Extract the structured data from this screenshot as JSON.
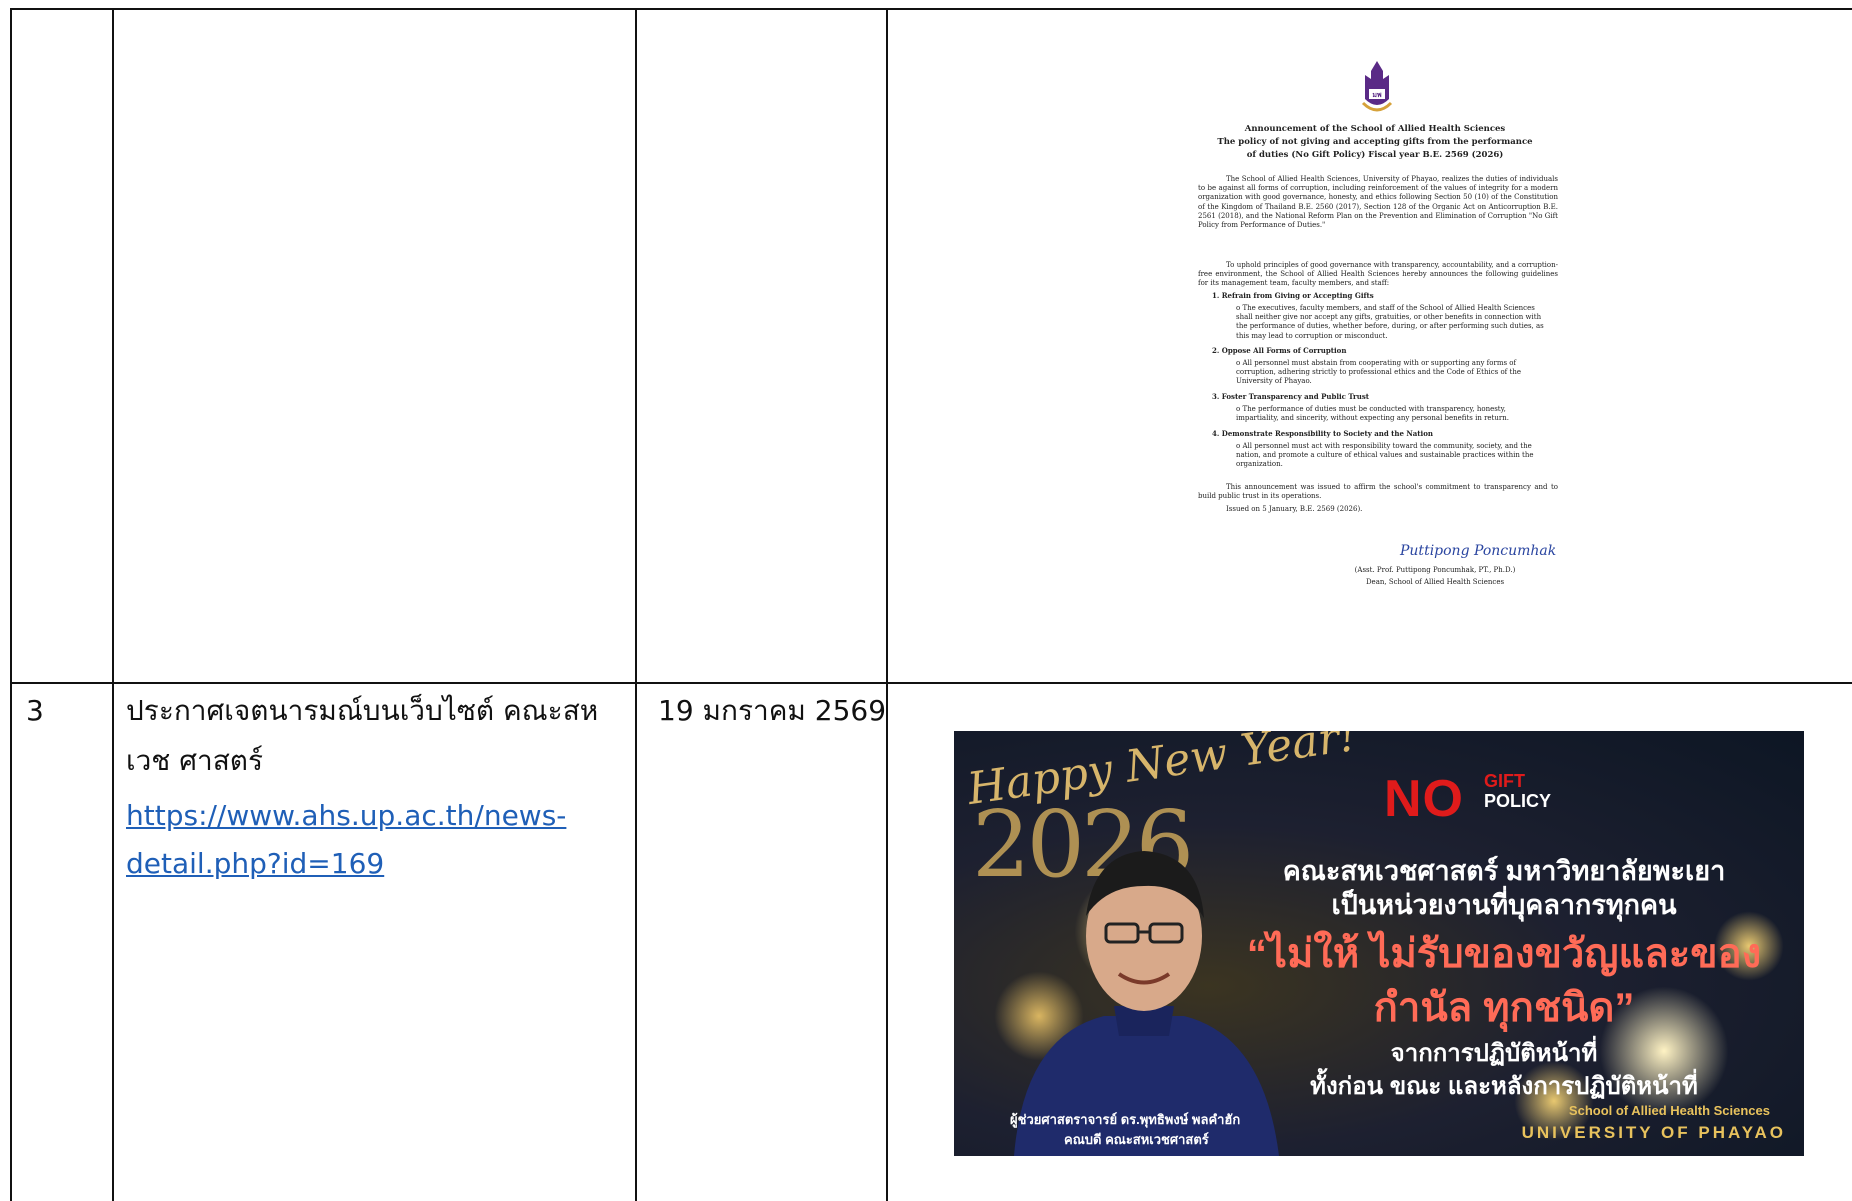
{
  "row2": {
    "announcement": {
      "header_lines": [
        "Announcement of the School of Allied Health Sciences",
        "The policy of not giving and accepting gifts from the performance",
        "of duties (No Gift Policy) Fiscal year B.E. 2569 (2026)"
      ],
      "para1": "The School of Allied Health Sciences, University of Phayao, realizes the duties of individuals to be against all forms of corruption, including reinforcement of the values of integrity for a modern organization with good governance, honesty, and ethics following Section 50 (10) of the Constitution of the Kingdom of Thailand B.E. 2560 (2017), Section 128 of the Organic Act on Anticorruption B.E. 2561 (2018), and the National Reform Plan on the Prevention and Elimination of Corruption \"No Gift Policy from Performance of Duties.\"",
      "para2": "To uphold principles of good governance with transparency, accountability, and a corruption-free environment, the School of Allied Health Sciences hereby announces the following guidelines for its management team, faculty members, and staff:",
      "items": [
        {
          "title": "1.  Refrain from Giving or Accepting Gifts",
          "body": "o  The executives, faculty members, and staff of the School of Allied Health Sciences shall neither give nor accept any gifts, gratuities, or other benefits in connection with the performance of duties, whether before, during, or after performing such duties, as this may lead to corruption or misconduct."
        },
        {
          "title": "2.  Oppose All Forms of Corruption",
          "body": "o  All personnel must abstain from cooperating with or supporting any forms of corruption, adhering strictly to professional ethics and the Code of Ethics of the University of Phayao."
        },
        {
          "title": "3.  Foster Transparency and Public Trust",
          "body": "o  The performance of duties must be conducted with transparency, honesty, impartiality, and sincerity, without expecting any personal benefits in return."
        },
        {
          "title": "4.  Demonstrate Responsibility to Society and the Nation",
          "body": "o  All personnel must act with responsibility toward the community, society, and the nation, and promote a culture of ethical values and sustainable practices within the organization."
        }
      ],
      "closing": "This announcement was issued to affirm the school's commitment to transparency and to build public trust in its operations.",
      "issued": "Issued on 5 January, B.E. 2569 (2026).",
      "signature": "Puttipong Poncumhak",
      "signer_name": "(Asst. Prof. Puttipong Poncumhak, PT., Ph.D.)",
      "signer_title": "Dean, School of Allied Health Sciences"
    }
  },
  "row3": {
    "number": "3",
    "title": "ประกาศเจตนารมณ์บนเว็บไซต์ คณะสหเวช ศาสตร์",
    "link_line1": "https://www.ahs.up.ac.th/news-",
    "link_line2": "detail.php?id=169",
    "date": "19 มกราคม 2569",
    "banner": {
      "greeting": "Happy New Year!",
      "year": "2026",
      "no": "NO",
      "gift": "GIFT",
      "policy": "POLICY",
      "line1": "คณะสหเวชศาสตร์ มหาวิทยาลัยพะเยา",
      "line2": "เป็นหน่วยงานที่บุคลากรทุกคน",
      "quote": "“ไม่ให้ ไม่รับของขวัญและของกำนัล ทุกชนิด”",
      "line3": "จากการปฏิบัติหน้าที่",
      "line4": "ทั้งก่อน ขณะ และหลังการปฏิบัติหน้าที่",
      "school": "School of Allied Health Sciences",
      "university": "UNIVERSITY OF PHAYAO",
      "caption1": "ผู้ช่วยศาสตราจารย์ ดร.พุทธิพงษ์ พลคำฮัก",
      "caption2": "คณบดี คณะสหเวชศาสตร์"
    }
  },
  "colors": {
    "link": "#1f5fb7",
    "rule": "#111111",
    "banner_quote": "#ff6b57",
    "banner_gold": "#e8c25d"
  }
}
